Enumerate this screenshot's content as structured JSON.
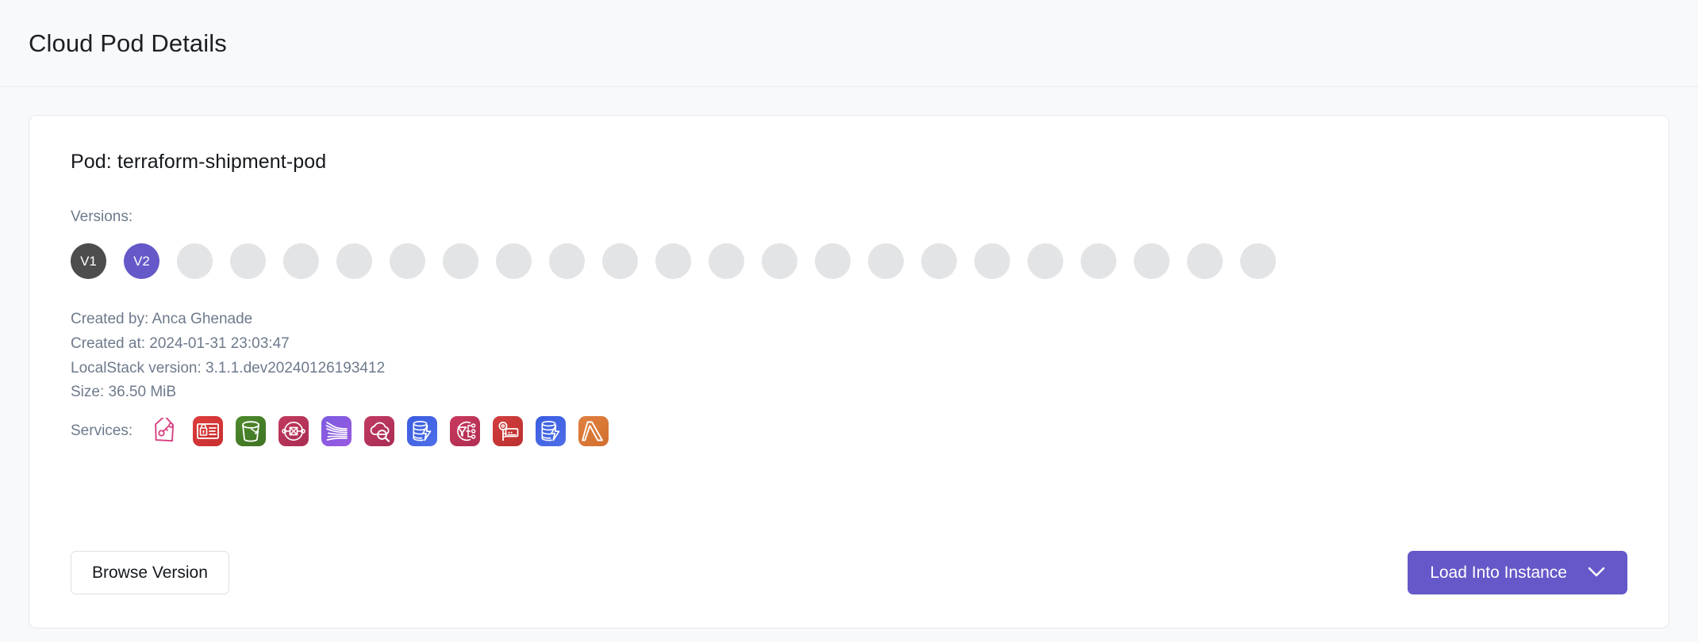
{
  "header": {
    "title": "Cloud Pod Details"
  },
  "pod": {
    "title": "Pod: terraform-shipment-pod",
    "versions_label": "Versions:",
    "versions": [
      {
        "label": "V1",
        "state": "filled",
        "color": "#4d4d4d"
      },
      {
        "label": "V2",
        "state": "selected",
        "color": "#6558c8"
      },
      {
        "label": "",
        "state": "empty",
        "color": "#e3e4e6"
      },
      {
        "label": "",
        "state": "empty",
        "color": "#e3e4e6"
      },
      {
        "label": "",
        "state": "empty",
        "color": "#e3e4e6"
      },
      {
        "label": "",
        "state": "empty",
        "color": "#e3e4e6"
      },
      {
        "label": "",
        "state": "empty",
        "color": "#e3e4e6"
      },
      {
        "label": "",
        "state": "empty",
        "color": "#e3e4e6"
      },
      {
        "label": "",
        "state": "empty",
        "color": "#e3e4e6"
      },
      {
        "label": "",
        "state": "empty",
        "color": "#e3e4e6"
      },
      {
        "label": "",
        "state": "empty",
        "color": "#e3e4e6"
      },
      {
        "label": "",
        "state": "empty",
        "color": "#e3e4e6"
      },
      {
        "label": "",
        "state": "empty",
        "color": "#e3e4e6"
      },
      {
        "label": "",
        "state": "empty",
        "color": "#e3e4e6"
      },
      {
        "label": "",
        "state": "empty",
        "color": "#e3e4e6"
      },
      {
        "label": "",
        "state": "empty",
        "color": "#e3e4e6"
      },
      {
        "label": "",
        "state": "empty",
        "color": "#e3e4e6"
      },
      {
        "label": "",
        "state": "empty",
        "color": "#e3e4e6"
      },
      {
        "label": "",
        "state": "empty",
        "color": "#e3e4e6"
      },
      {
        "label": "",
        "state": "empty",
        "color": "#e3e4e6"
      },
      {
        "label": "",
        "state": "empty",
        "color": "#e3e4e6"
      },
      {
        "label": "",
        "state": "empty",
        "color": "#e3e4e6"
      },
      {
        "label": "",
        "state": "empty",
        "color": "#e3e4e6"
      }
    ],
    "meta": {
      "created_by": "Created by: Anca Ghenade",
      "created_at": "Created at: 2024-01-31 23:03:47",
      "localstack_version": "LocalStack version: 3.1.1.dev20240126193412",
      "size": "Size: 36.50 MiB"
    },
    "services_label": "Services:",
    "services": [
      {
        "icon": "resource-tag-icon",
        "style": "plain",
        "color": "#d6407f"
      },
      {
        "icon": "iam-icon",
        "style": "tile",
        "color": "#dd3c3c",
        "color2": "#c93030"
      },
      {
        "icon": "s3-bucket-icon",
        "style": "tile",
        "color": "#4e8a2c",
        "color2": "#3f7324"
      },
      {
        "icon": "network-node-icon",
        "style": "tile",
        "color": "#c23a5e",
        "color2": "#a82d52"
      },
      {
        "icon": "kinesis-stream-icon",
        "style": "tile",
        "color": "#7b5be0",
        "color2": "#9a5ae0"
      },
      {
        "icon": "cloudwatch-search-icon",
        "style": "tile",
        "color": "#c23a63",
        "color2": "#a82d52"
      },
      {
        "icon": "dynamodb-icon",
        "style": "tile",
        "color": "#3a5ce0",
        "color2": "#4f6fe8"
      },
      {
        "icon": "eventbridge-icon",
        "style": "tile",
        "color": "#c93a5e",
        "color2": "#b02d52"
      },
      {
        "icon": "secrets-manager-icon",
        "style": "tile",
        "color": "#d33e3e",
        "color2": "#bb3030"
      },
      {
        "icon": "dynamodb-icon",
        "style": "tile",
        "color": "#3a5ce0",
        "color2": "#4f6fe8"
      },
      {
        "icon": "lambda-icon",
        "style": "tile",
        "color": "#e08040",
        "color2": "#d2702e"
      }
    ]
  },
  "footer": {
    "browse_label": "Browse Version",
    "load_label": "Load Into Instance"
  }
}
